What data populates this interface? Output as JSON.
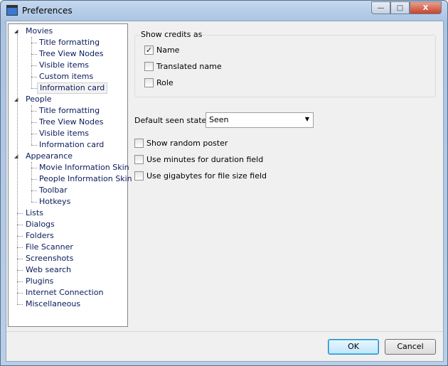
{
  "window": {
    "title": "Preferences",
    "minimize": "—",
    "maximize": "□",
    "close": "X"
  },
  "tree": [
    {
      "label": "Movies",
      "level": 0,
      "expanded": true
    },
    {
      "label": "Title formatting",
      "level": 1
    },
    {
      "label": "Tree View Nodes",
      "level": 1
    },
    {
      "label": "Visible items",
      "level": 1
    },
    {
      "label": "Custom items",
      "level": 1
    },
    {
      "label": "Information card",
      "level": 1,
      "selected": true
    },
    {
      "label": "People",
      "level": 0,
      "expanded": true
    },
    {
      "label": "Title formatting",
      "level": 1
    },
    {
      "label": "Tree View Nodes",
      "level": 1
    },
    {
      "label": "Visible items",
      "level": 1
    },
    {
      "label": "Information card",
      "level": 1
    },
    {
      "label": "Appearance",
      "level": 0,
      "expanded": true
    },
    {
      "label": "Movie Information Skin",
      "level": 1
    },
    {
      "label": "People Information Skin",
      "level": 1
    },
    {
      "label": "Toolbar",
      "level": 1
    },
    {
      "label": "Hotkeys",
      "level": 1
    },
    {
      "label": "Lists",
      "level": 0
    },
    {
      "label": "Dialogs",
      "level": 0
    },
    {
      "label": "Folders",
      "level": 0
    },
    {
      "label": "File Scanner",
      "level": 0
    },
    {
      "label": "Screenshots",
      "level": 0
    },
    {
      "label": "Web search",
      "level": 0
    },
    {
      "label": "Plugins",
      "level": 0
    },
    {
      "label": "Internet Connection",
      "level": 0
    },
    {
      "label": "Miscellaneous",
      "level": 0
    }
  ],
  "credits": {
    "title": "Show credits as",
    "options": [
      {
        "label": "Name",
        "checked": true
      },
      {
        "label": "Translated name",
        "checked": false
      },
      {
        "label": "Role",
        "checked": false
      }
    ]
  },
  "seen": {
    "label": "Default seen state:",
    "value": "Seen"
  },
  "options": [
    {
      "label": "Show random poster",
      "checked": false
    },
    {
      "label": "Use minutes for duration field",
      "checked": false
    },
    {
      "label": "Use gigabytes for file size field",
      "checked": false
    }
  ],
  "buttons": {
    "ok": "OK",
    "cancel": "Cancel"
  }
}
